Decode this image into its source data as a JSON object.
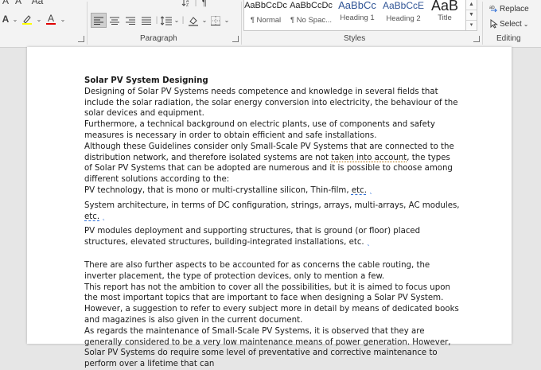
{
  "ribbon": {
    "font_size_label": "Aa",
    "paragraph_group_label": "Paragraph",
    "styles_group_label": "Styles",
    "editing_group_label": "Editing",
    "styles": [
      {
        "sample": "AaBbCcDc",
        "name": "¶ Normal"
      },
      {
        "sample": "AaBbCcDc",
        "name": "¶ No Spac..."
      },
      {
        "sample": "AaBbCc",
        "name": "Heading 1"
      },
      {
        "sample": "AaBbCcE",
        "name": "Heading 2"
      },
      {
        "sample": "AaB",
        "name": "Title"
      }
    ],
    "replace_label": "Replace",
    "select_label": "Select",
    "colors": {
      "highlight": "#ffff00",
      "font_color": "#e00000"
    }
  },
  "document": {
    "heading": "Solar PV System Designing",
    "p1": "Designing of Solar PV Systems needs competence and knowledge in several fields that include the solar radiation, the solar energy conversion into electricity, the behaviour of the solar devices and equipment.",
    "p2": "Furthermore, a technical background on electric plants, use of components and safety measures is necessary in order to obtain efficient and safe installations.",
    "p3_a": "Although these Guidelines consider only Small-Scale PV Systems that are connected to the distribution network, and therefore isolated systems are not ",
    "p3_flag": "taken into account",
    "p3_b": ", the types of Solar PV Systems that can be adopted are numerous and it is possible to choose among different solutions according to the:",
    "l1_a": "PV technology, that is mono or multi-crystalline silicon, Thin-film, ",
    "l1_flag": "etc.",
    "l2_a": "System architecture, in terms of DC configuration, strings, arrays, multi-arrays, AC modules, ",
    "l2_flag": "etc.",
    "l3": "PV modules deployment and supporting structures, that is ground (or floor) placed structures, elevated structures, building-integrated installations, etc. ",
    "p4": "There are also further aspects to be accounted for as concerns the cable routing, the inverter placement, the type of protection devices, only to mention a few.",
    "p5": "This report has not the ambition to cover all the possibilities, but it is aimed to focus upon the most important topics that are important to face when designing a Solar PV System. However, a suggestion to refer to every subject more in detail by means of dedicated books and magazines is also given in the current document.",
    "p6": "As regards the maintenance of Small-Scale PV Systems, it is observed that they are generally considered to be a very low maintenance means of power generation. However, Solar PV Systems do require some level of preventative and corrective maintenance to perform over a lifetime that can"
  }
}
